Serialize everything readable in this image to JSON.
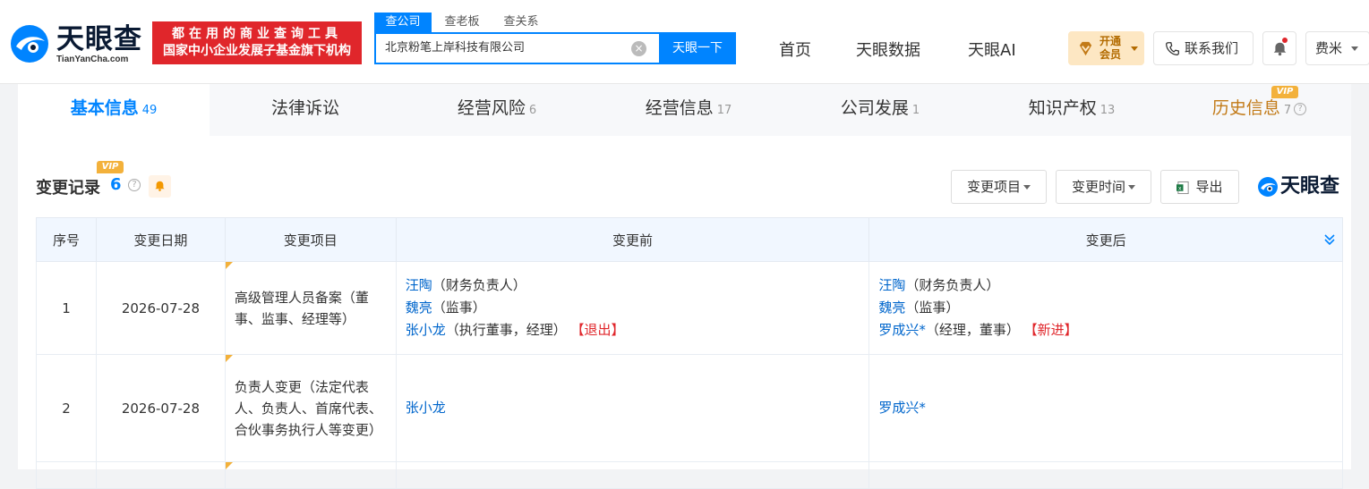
{
  "header": {
    "logo_cn": "天眼查",
    "logo_en": "TianYanCha.com",
    "slogan_line1": "都在用的商业查询工具",
    "slogan_line2": "国家中小企业发展子基金旗下机构",
    "search_tabs": [
      "查公司",
      "查老板",
      "查关系"
    ],
    "search_value": "北京粉笔上岸科技有限公司",
    "search_button": "天眼一下",
    "nav": [
      "首页",
      "天眼数据",
      "天眼AI"
    ],
    "vip_label_1": "开通",
    "vip_label_2": "会员",
    "contact_label": "联系我们",
    "user_name": "费米"
  },
  "tabs": [
    {
      "label": "基本信息",
      "count": "49"
    },
    {
      "label": "法律诉讼",
      "count": ""
    },
    {
      "label": "经营风险",
      "count": "6"
    },
    {
      "label": "经营信息",
      "count": "17"
    },
    {
      "label": "公司发展",
      "count": "1"
    },
    {
      "label": "知识产权",
      "count": "13"
    },
    {
      "label": "历史信息",
      "count": "7"
    }
  ],
  "vip_tag": "VIP",
  "section": {
    "title": "变更记录",
    "count": "6",
    "filter_item": "变更项目",
    "filter_time": "变更时间",
    "export": "导出",
    "brand": "天眼查"
  },
  "table": {
    "headers": [
      "序号",
      "变更日期",
      "变更项目",
      "变更前",
      "变更后"
    ],
    "rows": [
      {
        "no": "1",
        "date": "2026-07-28",
        "item": "高级管理人员备案（董事、监事、经理等）",
        "before": [
          {
            "name": "汪陶",
            "role": "（财务负责人）",
            "tag": ""
          },
          {
            "name": "魏亮",
            "role": "（监事）",
            "tag": ""
          },
          {
            "name": "张小龙",
            "role": "（执行董事，经理）",
            "tag": "【退出】"
          }
        ],
        "after": [
          {
            "name": "汪陶",
            "role": "（财务负责人）",
            "tag": ""
          },
          {
            "name": "魏亮",
            "role": "（监事）",
            "tag": ""
          },
          {
            "name": "罗成兴*",
            "role": "（经理，董事）",
            "tag": "【新进】"
          }
        ]
      },
      {
        "no": "2",
        "date": "2026-07-28",
        "item": "负责人变更（法定代表人、负责人、首席代表、合伙事务执行人等变更）",
        "before_name": "张小龙",
        "after_name": "罗成兴*"
      }
    ]
  },
  "colors": {
    "accent": "#0084ff",
    "red": "#e0262b",
    "vip": "#f3b13b"
  }
}
